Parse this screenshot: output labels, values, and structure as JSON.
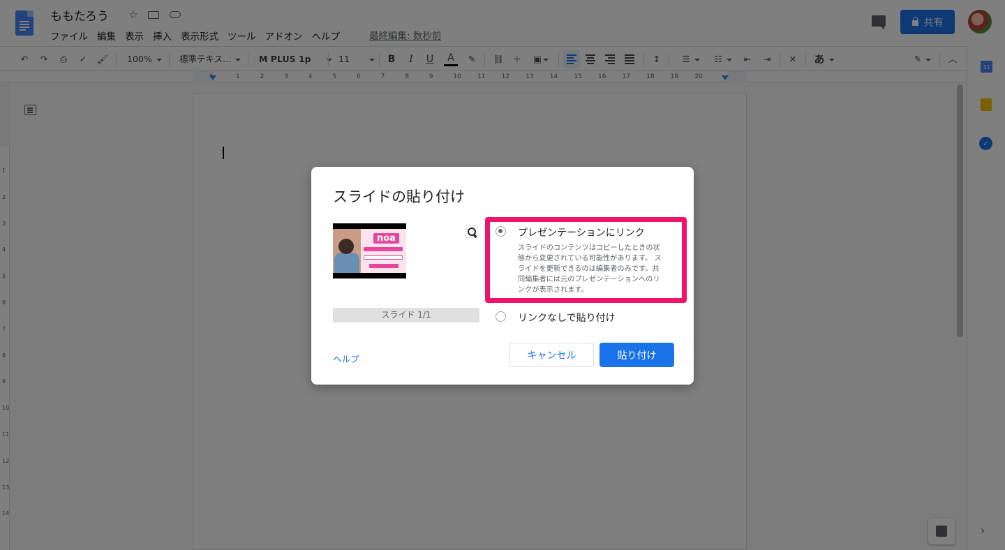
{
  "header": {
    "doc_title": "ももたろう",
    "last_edit": "最終編集: 数秒前",
    "share_label": "共有",
    "menu": [
      "ファイル",
      "編集",
      "表示",
      "挿入",
      "表示形式",
      "ツール",
      "アドオン",
      "ヘルプ"
    ]
  },
  "toolbar": {
    "zoom": "100%",
    "style": "標準テキス...",
    "font": "M PLUS 1p",
    "font_size": "11",
    "bold": "B",
    "italic": "I",
    "underline": "U",
    "text_color": "A",
    "input_tools": "あ"
  },
  "ruler": {
    "h_labels": [
      "1",
      "1",
      "2",
      "3",
      "4",
      "5",
      "6",
      "7",
      "8",
      "9",
      "10",
      "11",
      "12",
      "13",
      "14",
      "15",
      "16",
      "17",
      "18",
      "19",
      "20"
    ],
    "v_labels": [
      "1",
      "2",
      "3",
      "4",
      "5",
      "6",
      "7",
      "8",
      "9",
      "10",
      "11",
      "12",
      "13",
      "14"
    ]
  },
  "side_panel": {
    "calendar_day": "31"
  },
  "dialog": {
    "title": "スライドの貼り付け",
    "slide_counter": "スライド 1/1",
    "option_link": {
      "label": "プレゼンテーションにリンク",
      "description": "スライドのコンテンツはコピーしたときの状態から変更されている可能性があります。 スライドを更新できるのは編集者のみです。共同編集者には元のプレゼンテーションへのリンクが表示されます。",
      "selected": true
    },
    "option_nolink": {
      "label": "リンクなしで貼り付け",
      "selected": false
    },
    "help": "ヘルプ",
    "cancel": "キャンセル",
    "paste": "貼り付け",
    "thumbnail_logo": "noa"
  },
  "colors": {
    "accent": "#1a73e8",
    "highlight": "#f0136b"
  }
}
